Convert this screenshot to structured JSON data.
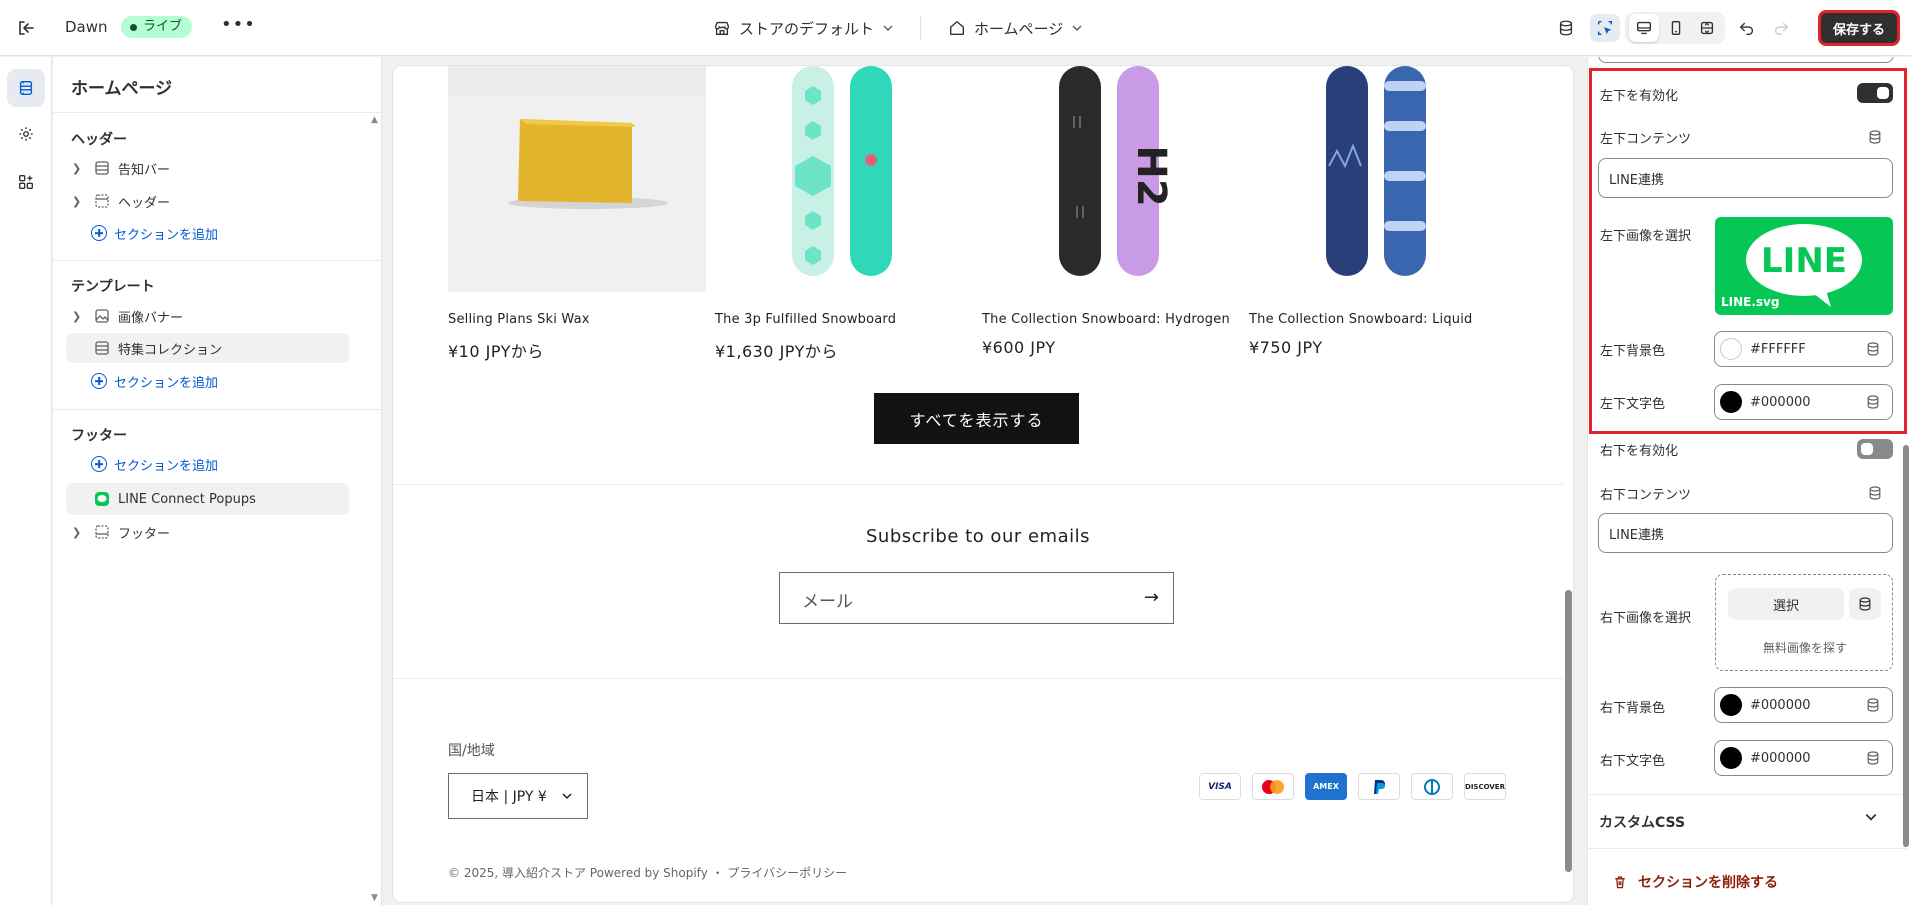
{
  "topbar": {
    "theme_name": "Dawn",
    "status_badge": "ライブ",
    "more": "•••",
    "store_selector": "ストアのデフォルト",
    "page_selector": "ホームページ",
    "save_label": "保存する"
  },
  "sidebar": {
    "title": "ホームページ",
    "header_section": {
      "heading": "ヘッダー",
      "items": [
        {
          "label": "告知バー"
        },
        {
          "label": "ヘッダー"
        }
      ],
      "add_label": "セクションを追加"
    },
    "template_section": {
      "heading": "テンプレート",
      "items": [
        {
          "label": "画像バナー"
        },
        {
          "label": "特集コレクション"
        }
      ],
      "add_label": "セクションを追加"
    },
    "footer_section": {
      "heading": "フッター",
      "add_label": "セクションを追加",
      "items": [
        {
          "label": "LINE Connect Popups"
        },
        {
          "label": "フッター"
        }
      ]
    }
  },
  "preview": {
    "products": [
      {
        "name": "Selling Plans Ski Wax",
        "price": "¥10 JPYから"
      },
      {
        "name": "The 3p Fulfilled Snowboard",
        "price": "¥1,630 JPYから"
      },
      {
        "name": "The Collection Snowboard: Hydrogen",
        "price": "¥600 JPY"
      },
      {
        "name": "The Collection Snowboard: Liquid",
        "price": "¥750 JPY"
      }
    ],
    "view_all_label": "すべてを表示する",
    "subscribe_title": "Subscribe to our emails",
    "email_placeholder": "メール",
    "country_label": "国/地域",
    "country_value": "日本 | JPY ¥",
    "payment_icons": [
      "VISA",
      "Mastercard",
      "AMEX",
      "PayPal",
      "Diners",
      "DISCOVER"
    ],
    "copyright": "© 2025, 導入紹介ストア Powered by Shopify ・ プライバシーポリシー"
  },
  "settings": {
    "left_enable_label": "左下を有効化",
    "left_enable": true,
    "left_content_label": "左下コンテンツ",
    "left_content_value": "LINE連携",
    "left_image_label": "左下画像を選択",
    "left_image_file": "LINE.svg",
    "left_image_logo_text": "LINE",
    "left_bg_label": "左下背景色",
    "left_bg_value": "#FFFFFF",
    "left_text_label": "左下文字色",
    "left_text_value": "#000000",
    "right_enable_label": "右下を有効化",
    "right_enable": false,
    "right_content_label": "右下コンテンツ",
    "right_content_value": "LINE連携",
    "right_image_label": "右下画像を選択",
    "select_label": "選択",
    "free_images_label": "無料画像を探す",
    "right_bg_label": "右下背景色",
    "right_bg_value": "#000000",
    "right_text_label": "右下文字色",
    "right_text_value": "#000000",
    "custom_css_label": "カスタムCSS",
    "delete_section_label": "セクションを削除する"
  },
  "colors": {
    "accent_blue": "#005bd3",
    "highlight_red": "#e0242b",
    "line_green": "#06c755",
    "live_badge_bg": "#b4fed2",
    "delete_red": "#8e1f0b"
  }
}
